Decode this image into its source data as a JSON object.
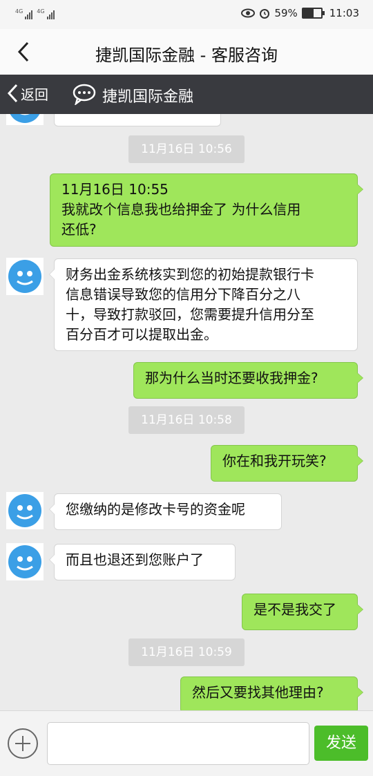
{
  "status_bar": {
    "network_1": "4G",
    "network_2": "4G",
    "battery": "59%",
    "battery_level": 0.59,
    "time": "11:03"
  },
  "header": {
    "title": "捷凯国际金融 - 客服咨询"
  },
  "subheader": {
    "back_label": "返回",
    "title": "捷凯国际金融"
  },
  "messages": [
    {
      "type": "timestamp",
      "text": "11月16日 10:56"
    },
    {
      "type": "out",
      "lines": [
        "11月16日 10:55",
        "我就改个信息我也给押金了  为什么信用",
        "还低?"
      ]
    },
    {
      "type": "in",
      "lines": [
        "财务出金系统核实到您的初始提款银行卡",
        "信息错误导致您的信用分下降百分之八",
        "十，导致打款驳回，您需要提升信用分至",
        "百分百才可以提取出金。"
      ]
    },
    {
      "type": "out",
      "lines": [
        "那为什么当时还要收我押金?"
      ]
    },
    {
      "type": "timestamp",
      "text": "11月16日 10:58"
    },
    {
      "type": "out",
      "lines": [
        "你在和我开玩笑?"
      ]
    },
    {
      "type": "in",
      "lines": [
        "您缴纳的是修改卡号的资金呢"
      ]
    },
    {
      "type": "in",
      "lines": [
        "而且也退还到您账户了"
      ]
    },
    {
      "type": "out",
      "lines": [
        "是不是我交了"
      ]
    },
    {
      "type": "timestamp",
      "text": "11月16日 10:59"
    },
    {
      "type": "out",
      "lines": [
        "然后又要找其他理由?"
      ]
    }
  ],
  "input_bar": {
    "placeholder": "",
    "send_label": "发送"
  },
  "colors": {
    "out_bubble": "#9fe65b",
    "send_button": "#4cbd2a",
    "subheader_bg": "#393a3f"
  }
}
